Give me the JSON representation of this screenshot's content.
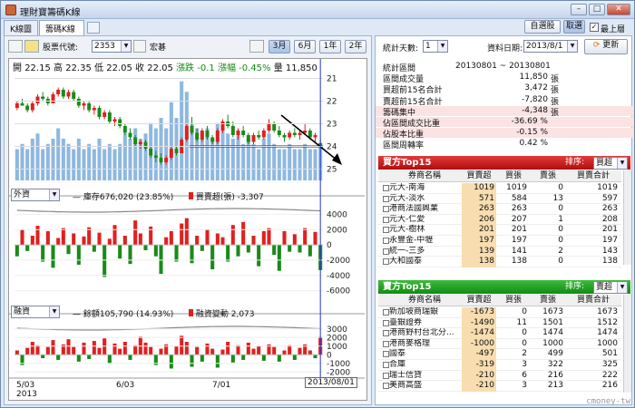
{
  "window": {
    "title": "理財寶籌碼K線"
  },
  "tabs": [
    "K線圖",
    "籌碼K線"
  ],
  "header_buttons": {
    "custom": "自選股",
    "ranking": "取選",
    "always_on_top": "最上層"
  },
  "toolbar_left": {
    "stock_code_label": "股票代號:",
    "stock_code": "2353",
    "stock_name": "宏碁",
    "periods": [
      "3月",
      "6月",
      "1年",
      "2年"
    ],
    "active_period": "3月"
  },
  "toolbar_right": {
    "days_label": "統計天數:",
    "days_value": "1",
    "date_label": "資料日期:",
    "date_value": "2013/8/1",
    "update": "更新"
  },
  "ohlc": {
    "open_label": "開",
    "open": "22.15",
    "high_label": "高",
    "high": "22.35",
    "low_label": "低",
    "low": "22.05",
    "close_label": "收",
    "close": "22.05",
    "change_label": "漲跌",
    "change": "-0.1",
    "pct_label": "漲幅",
    "pct": "-0.45%",
    "vol_label": "量",
    "vol": "11,850"
  },
  "indicator1": {
    "select": "外資",
    "legend_a": "庫存676,020 (23.85%)",
    "legend_b": "買賣超(張) -3,307"
  },
  "indicator2": {
    "select": "融資",
    "legend_a": "餘額105,790 (14.93%)",
    "legend_b": "融資變動 2,073"
  },
  "x_axis": {
    "labels": [
      "5/03",
      "6/03",
      "7/01"
    ],
    "year": "2013",
    "cursor_date": "2013/08/01"
  },
  "price_ticks": [
    "25",
    "24",
    "23",
    "22",
    "21"
  ],
  "ind1_ticks": [
    "4000",
    "2000",
    "0",
    "-2000",
    "-4000",
    "-6000"
  ],
  "ind2_ticks": [
    "3000",
    "2000",
    "1000",
    "0",
    "-1000",
    "-2000"
  ],
  "stats": [
    {
      "k": "統計區間",
      "v": "20130801 ~ 20130801",
      "u": "",
      "pink": false
    },
    {
      "k": "區間成交量",
      "v": "11,850",
      "u": "張",
      "pink": false
    },
    {
      "k": "買超前15名合計",
      "v": "3,472",
      "u": "張",
      "pink": false
    },
    {
      "k": "賣超前15名合計",
      "v": "-7,820",
      "u": "張",
      "pink": false
    },
    {
      "k": "籌碼集中",
      "v": "-4,348",
      "u": "張",
      "pink": true
    },
    {
      "k": "佔區間成交比重",
      "v": "-36.69 %",
      "u": "",
      "pink": true
    },
    {
      "k": "佔股本比重",
      "v": "-0.15 %",
      "u": "",
      "pink": true
    },
    {
      "k": "區間周轉率",
      "v": "0.42 %",
      "u": "",
      "pink": false
    }
  ],
  "buy_top": {
    "title": "買方Top15",
    "sort_label": "排序:",
    "sort_value": "買超",
    "headers": [
      "券商名稱",
      "買賣超",
      "買張",
      "賣張",
      "買賣合計"
    ],
    "rows": [
      [
        "元大-南海",
        "1019",
        "1019",
        "0",
        "1019"
      ],
      [
        "元大-淡水",
        "571",
        "584",
        "13",
        "597"
      ],
      [
        "港商法國興業",
        "263",
        "263",
        "0",
        "263"
      ],
      [
        "元大-仁愛",
        "206",
        "207",
        "1",
        "208"
      ],
      [
        "元大-樹林",
        "201",
        "201",
        "0",
        "201"
      ],
      [
        "永豐金-中壢",
        "197",
        "197",
        "0",
        "197"
      ],
      [
        "統一-三多",
        "139",
        "141",
        "2",
        "143"
      ],
      [
        "大和國泰",
        "138",
        "138",
        "0",
        "138"
      ]
    ]
  },
  "sell_top": {
    "title": "賣方Top15",
    "sort_label": "排序:",
    "sort_value": "賣超",
    "headers": [
      "券商名稱",
      "買賣超",
      "買張",
      "賣張",
      "買賣合計"
    ],
    "rows": [
      [
        "新加坡商瑞銀",
        "-1673",
        "0",
        "1673",
        "1673"
      ],
      [
        "臺銀證券",
        "-1490",
        "11",
        "1501",
        "1512"
      ],
      [
        "港商野村台北分...",
        "-1474",
        "0",
        "1474",
        "1474"
      ],
      [
        "港商麥格理",
        "-1000",
        "0",
        "1000",
        "1000"
      ],
      [
        "國泰",
        "-497",
        "2",
        "499",
        "501"
      ],
      [
        "合庫",
        "-319",
        "3",
        "322",
        "325"
      ],
      [
        "瑞士信貸",
        "-210",
        "6",
        "216",
        "222"
      ],
      [
        "美商高盛",
        "-210",
        "3",
        "213",
        "216"
      ]
    ]
  },
  "watermark": "cmoney-tw",
  "colors": {
    "up": "#e02020",
    "down": "#1a8a1a",
    "volume": "#8fb8e0",
    "trend_line": "#1a1acc",
    "cursor": "#2233cc"
  },
  "chart_data": [
    {
      "type": "candlestick",
      "title": "",
      "y_ticks": [
        21,
        22,
        23,
        24,
        25
      ],
      "ylim": [
        20.5,
        25.3
      ],
      "candles": [
        [
          23.7,
          24.0,
          23.6,
          23.9
        ],
        [
          23.9,
          24.1,
          23.8,
          23.8
        ],
        [
          23.8,
          23.9,
          23.5,
          23.6
        ],
        [
          23.6,
          24.0,
          23.5,
          23.9
        ],
        [
          23.9,
          24.3,
          23.8,
          24.2
        ],
        [
          24.2,
          24.4,
          24.0,
          24.1
        ],
        [
          24.1,
          24.2,
          23.8,
          23.9
        ],
        [
          23.9,
          24.4,
          23.9,
          24.3
        ],
        [
          24.3,
          24.6,
          24.2,
          24.5
        ],
        [
          24.5,
          24.6,
          24.1,
          24.2
        ],
        [
          24.2,
          24.5,
          24.1,
          24.4
        ],
        [
          24.4,
          24.5,
          24.0,
          24.1
        ],
        [
          24.1,
          24.2,
          23.7,
          23.8
        ],
        [
          23.8,
          24.0,
          23.6,
          23.9
        ],
        [
          23.9,
          24.0,
          23.5,
          23.6
        ],
        [
          23.6,
          23.8,
          23.4,
          23.7
        ],
        [
          23.7,
          23.8,
          23.2,
          23.3
        ],
        [
          23.3,
          23.6,
          23.2,
          23.5
        ],
        [
          23.5,
          23.6,
          23.0,
          23.1
        ],
        [
          23.1,
          23.3,
          22.9,
          23.2
        ],
        [
          23.2,
          23.3,
          22.8,
          22.9
        ],
        [
          22.9,
          23.0,
          22.5,
          22.6
        ],
        [
          22.6,
          22.8,
          22.3,
          22.4
        ],
        [
          22.4,
          22.5,
          22.0,
          22.1
        ],
        [
          22.1,
          22.3,
          21.9,
          22.2
        ],
        [
          22.2,
          22.3,
          21.8,
          21.9
        ],
        [
          21.9,
          22.0,
          21.5,
          21.6
        ],
        [
          21.6,
          21.8,
          21.3,
          21.5
        ],
        [
          21.5,
          21.7,
          21.2,
          21.3
        ],
        [
          21.3,
          21.6,
          21.2,
          21.5
        ],
        [
          21.5,
          22.0,
          21.4,
          21.9
        ],
        [
          21.9,
          22.0,
          21.6,
          21.7
        ],
        [
          21.7,
          22.4,
          21.7,
          22.3
        ],
        [
          22.3,
          23.0,
          22.2,
          22.9
        ],
        [
          22.9,
          23.3,
          22.5,
          22.6
        ],
        [
          22.6,
          22.8,
          22.2,
          22.3
        ],
        [
          22.3,
          22.8,
          22.2,
          22.7
        ],
        [
          22.7,
          22.9,
          22.3,
          22.4
        ],
        [
          22.4,
          22.5,
          22.1,
          22.2
        ],
        [
          22.2,
          22.8,
          22.1,
          22.7
        ],
        [
          22.7,
          23.2,
          22.6,
          23.1
        ],
        [
          23.1,
          23.4,
          22.8,
          22.9
        ],
        [
          22.9,
          23.1,
          22.4,
          22.5
        ],
        [
          22.5,
          22.8,
          22.3,
          22.7
        ],
        [
          22.7,
          22.9,
          22.4,
          22.5
        ],
        [
          22.5,
          22.6,
          22.1,
          22.2
        ],
        [
          22.2,
          22.6,
          22.1,
          22.5
        ],
        [
          22.5,
          22.7,
          22.3,
          22.4
        ],
        [
          22.4,
          22.8,
          22.3,
          22.7
        ],
        [
          22.7,
          23.2,
          22.6,
          23.0
        ],
        [
          23.0,
          23.1,
          22.6,
          22.7
        ],
        [
          22.7,
          22.9,
          22.4,
          22.5
        ],
        [
          22.5,
          22.6,
          22.2,
          22.4
        ],
        [
          22.4,
          22.7,
          22.3,
          22.6
        ],
        [
          22.6,
          22.8,
          22.4,
          22.5
        ],
        [
          22.5,
          22.7,
          22.3,
          22.6
        ],
        [
          22.6,
          23.0,
          22.5,
          22.7
        ],
        [
          22.7,
          22.8,
          22.3,
          22.4
        ],
        [
          22.4,
          22.6,
          22.2,
          22.5
        ],
        [
          22.15,
          22.35,
          22.05,
          22.05
        ]
      ],
      "volumes": [
        0.3,
        0.35,
        0.3,
        0.4,
        0.45,
        0.3,
        0.35,
        0.4,
        0.5,
        0.4,
        0.35,
        0.3,
        0.4,
        0.3,
        0.35,
        0.3,
        0.4,
        0.3,
        0.35,
        0.3,
        0.35,
        0.45,
        0.4,
        0.5,
        0.4,
        0.45,
        0.55,
        0.5,
        0.6,
        0.5,
        0.75,
        0.6,
        0.95,
        0.85,
        0.55,
        0.5,
        0.45,
        0.5,
        0.4,
        0.55,
        0.5,
        0.45,
        0.4,
        0.45,
        0.35,
        0.4,
        0.35,
        0.3,
        0.4,
        0.45,
        0.35,
        0.3,
        0.3,
        0.35,
        0.3,
        0.3,
        0.35,
        0.3,
        0.3,
        0.35
      ]
    },
    {
      "type": "bar",
      "title": "外資",
      "ylim": [
        -7000,
        5000
      ],
      "y_ticks": [
        4000,
        2000,
        0,
        -2000,
        -4000,
        -6000
      ],
      "values": [
        -1500,
        2000,
        -800,
        1200,
        2500,
        -2200,
        1800,
        -3000,
        900,
        2200,
        -1200,
        1500,
        -2600,
        1100,
        2300,
        -900,
        1600,
        -4200,
        800,
        2600,
        -1800,
        1200,
        -2500,
        3200,
        1500,
        -700,
        2400,
        -1500,
        -3800,
        1000,
        1800,
        -2200,
        2800,
        3500,
        -2400,
        1200,
        -800,
        2000,
        -3200,
        1500,
        1000,
        -2200,
        2600,
        -1500,
        3000,
        -1000,
        1200,
        -2800,
        1800,
        2200,
        -1300,
        -3400,
        1800,
        -900,
        1400,
        -1000,
        2200,
        -1500,
        1700,
        -3307
      ]
    },
    {
      "type": "bar",
      "title": "融資",
      "ylim": [
        -2500,
        3500
      ],
      "y_ticks": [
        3000,
        2000,
        1000,
        0,
        -1000,
        -2000
      ],
      "values": [
        500,
        -1200,
        800,
        1500,
        1100,
        -400,
        900,
        1700,
        -600,
        1200,
        1800,
        900,
        -800,
        1400,
        -500,
        1600,
        800,
        1900,
        -1000,
        1300,
        700,
        1500,
        -600,
        1100,
        2100,
        1400,
        900,
        -1200,
        700,
        1200,
        -1600,
        1000,
        2200,
        1500,
        -1400,
        900,
        -800,
        1300,
        700,
        -1500,
        600,
        1500,
        -900,
        1100,
        -600,
        1400,
        700,
        1000,
        -700,
        1200,
        900,
        -800,
        500,
        1100,
        -600,
        800,
        1200,
        500,
        -400,
        2073
      ]
    }
  ]
}
